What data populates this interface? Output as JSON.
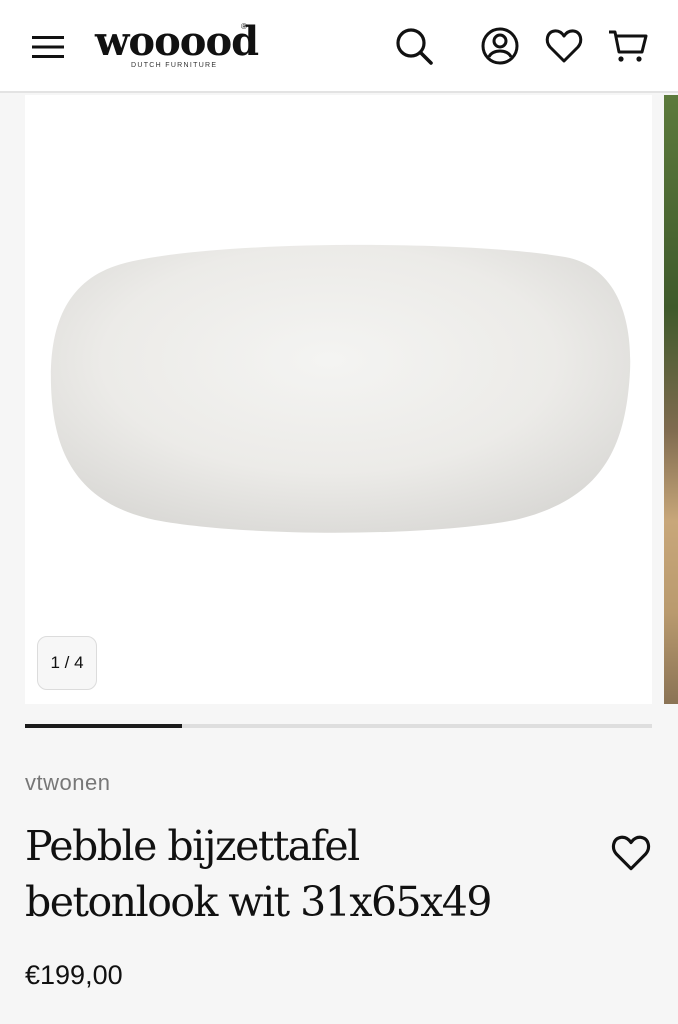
{
  "header": {
    "logo_text": "wooood",
    "logo_tagline": "DUTCH FURNITURE",
    "logo_registered": "®",
    "icons": [
      "menu-icon",
      "search-icon",
      "account-icon",
      "heart-icon",
      "cart-icon"
    ]
  },
  "gallery": {
    "counter": "1 / 4",
    "current_image": 1,
    "total_images": 4
  },
  "product": {
    "brand": "vtwonen",
    "title": "Pebble bijzettafel betonlook wit 31x65x49",
    "price": "€199,00"
  },
  "colors": {
    "header_bg": "#ffffff",
    "page_bg": "#f6f6f6",
    "accent": "#111111",
    "brand_text": "#777777",
    "progress_track": "#dedede",
    "progress_fill": "#1b1b1b"
  },
  "progress": {
    "fraction": 0.25
  }
}
